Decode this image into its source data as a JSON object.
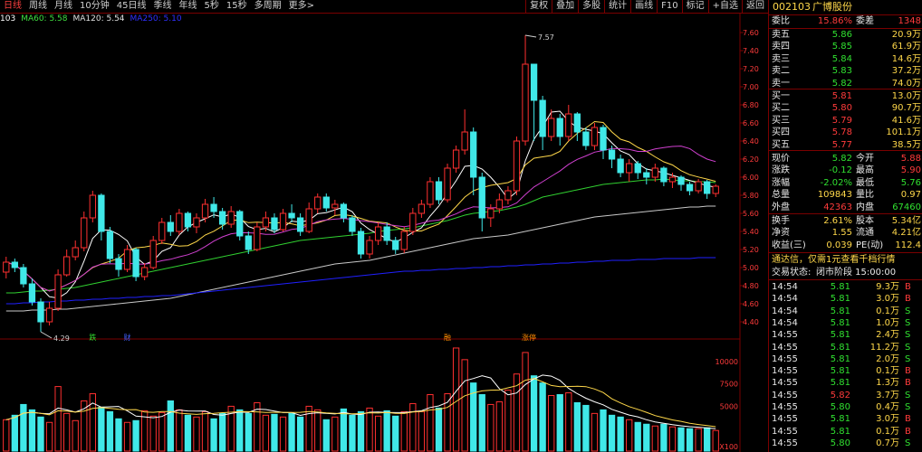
{
  "toolbar": {
    "tabs": [
      "日线",
      "周线",
      "月线",
      "10分钟",
      "45日线",
      "季线",
      "年线",
      "5秒",
      "15秒",
      "多周期",
      "更多>"
    ],
    "active_tab": 0,
    "tools": [
      "复权",
      "叠加",
      "多股",
      "统计",
      "画线",
      "F10",
      "标记",
      "+自选",
      "返回"
    ]
  },
  "ma_legend": [
    {
      "text": "103",
      "color": "#ffffff"
    },
    {
      "text": "MA60: 5.58",
      "color": "#40e040"
    },
    {
      "text": "MA120: 5.54",
      "color": "#e0e0e0"
    },
    {
      "text": "MA250: 5.10",
      "color": "#3030ff"
    }
  ],
  "chart_data": {
    "type": "candlestick",
    "y_ticks": [
      4.4,
      4.6,
      4.8,
      5.0,
      5.2,
      5.4,
      5.6,
      5.8,
      6.0,
      6.2,
      6.4,
      6.6,
      6.8,
      7.0,
      7.2,
      7.4,
      7.6
    ],
    "y_tick_labels": [
      "4.40",
      "4.60",
      "4.80",
      "5.00",
      "5.20",
      "5.40",
      "5.60",
      "5.80",
      "6.00",
      "6.20",
      "6.40",
      "6.60",
      "6.80",
      "7.00",
      "7.20",
      "7.40",
      "7.60"
    ],
    "ylim": [
      4.28,
      7.74
    ],
    "annotations": [
      {
        "text": "7.57",
        "index": 60,
        "value": 7.57
      },
      {
        "text": "4.29",
        "index": 4,
        "value": 4.29
      }
    ],
    "markers": [
      {
        "text": "跌",
        "index": 10,
        "color": "#30e030"
      },
      {
        "text": "财",
        "index": 14,
        "color": "#4060ff"
      },
      {
        "text": "融",
        "index": 51,
        "color": "#ff8c00"
      },
      {
        "text": "涨停",
        "index": 60,
        "color": "#ff8c00"
      }
    ],
    "candles": [
      [
        4.95,
        5.06,
        5.12,
        4.88
      ],
      [
        5.06,
        5.0,
        5.1,
        4.95
      ],
      [
        5.0,
        4.82,
        5.04,
        4.78
      ],
      [
        4.82,
        4.62,
        4.88,
        4.58
      ],
      [
        4.62,
        4.4,
        4.66,
        4.29
      ],
      [
        4.4,
        4.55,
        4.62,
        4.36
      ],
      [
        4.55,
        4.92,
        4.98,
        4.52
      ],
      [
        4.92,
        5.12,
        5.2,
        4.9
      ],
      [
        5.12,
        5.22,
        5.3,
        5.08
      ],
      [
        5.22,
        5.55,
        5.62,
        5.18
      ],
      [
        5.55,
        5.8,
        5.85,
        5.5
      ],
      [
        5.8,
        5.4,
        5.82,
        5.3
      ],
      [
        5.4,
        5.1,
        5.45,
        5.05
      ],
      [
        5.1,
        4.98,
        5.15,
        4.9
      ],
      [
        4.98,
        5.2,
        5.25,
        4.95
      ],
      [
        5.2,
        4.9,
        5.22,
        4.85
      ],
      [
        4.9,
        5.0,
        5.05,
        4.86
      ],
      [
        5.0,
        5.3,
        5.35,
        4.98
      ],
      [
        5.3,
        5.5,
        5.55,
        5.26
      ],
      [
        5.5,
        5.4,
        5.58,
        5.35
      ],
      [
        5.4,
        5.6,
        5.65,
        5.36
      ],
      [
        5.6,
        5.45,
        5.62,
        5.4
      ],
      [
        5.45,
        5.55,
        5.6,
        5.38
      ],
      [
        5.55,
        5.7,
        5.76,
        5.5
      ],
      [
        5.7,
        5.62,
        5.78,
        5.55
      ],
      [
        5.62,
        5.48,
        5.66,
        5.42
      ],
      [
        5.48,
        5.62,
        5.68,
        5.44
      ],
      [
        5.62,
        5.35,
        5.64,
        5.3
      ],
      [
        5.35,
        5.2,
        5.4,
        5.15
      ],
      [
        5.2,
        5.45,
        5.5,
        5.18
      ],
      [
        5.45,
        5.55,
        5.62,
        5.4
      ],
      [
        5.55,
        5.42,
        5.6,
        5.38
      ],
      [
        5.42,
        5.6,
        5.65,
        5.4
      ],
      [
        5.6,
        5.55,
        5.7,
        5.5
      ],
      [
        5.55,
        5.4,
        5.6,
        5.35
      ],
      [
        5.4,
        5.65,
        5.72,
        5.38
      ],
      [
        5.65,
        5.78,
        5.82,
        5.6
      ],
      [
        5.78,
        5.66,
        5.82,
        5.62
      ],
      [
        5.66,
        5.7,
        5.75,
        5.58
      ],
      [
        5.7,
        5.55,
        5.72,
        5.5
      ],
      [
        5.55,
        5.4,
        5.58,
        5.35
      ],
      [
        5.4,
        5.15,
        5.44,
        5.1
      ],
      [
        5.15,
        5.3,
        5.35,
        5.1
      ],
      [
        5.3,
        5.45,
        5.5,
        5.25
      ],
      [
        5.45,
        5.3,
        5.5,
        5.25
      ],
      [
        5.3,
        5.2,
        5.34,
        5.15
      ],
      [
        5.2,
        5.4,
        5.45,
        5.16
      ],
      [
        5.4,
        5.6,
        5.66,
        5.36
      ],
      [
        5.6,
        5.7,
        5.75,
        5.55
      ],
      [
        5.7,
        5.95,
        6.0,
        5.66
      ],
      [
        5.95,
        5.75,
        6.0,
        5.7
      ],
      [
        5.75,
        6.1,
        6.15,
        5.72
      ],
      [
        6.1,
        6.3,
        6.35,
        6.05
      ],
      [
        6.3,
        6.5,
        6.75,
        6.25
      ],
      [
        6.5,
        6.0,
        6.55,
        5.8
      ],
      [
        6.0,
        5.55,
        6.05,
        5.4
      ],
      [
        5.55,
        5.65,
        5.7,
        5.45
      ],
      [
        5.65,
        5.75,
        5.82,
        5.6
      ],
      [
        5.75,
        5.85,
        5.9,
        5.7
      ],
      [
        5.85,
        6.4,
        6.45,
        5.8
      ],
      [
        6.4,
        7.25,
        7.57,
        6.35
      ],
      [
        7.25,
        6.85,
        7.1,
        6.4
      ],
      [
        6.85,
        6.45,
        6.9,
        6.3
      ],
      [
        6.45,
        6.65,
        6.75,
        6.4
      ],
      [
        6.65,
        6.45,
        6.7,
        6.35
      ],
      [
        6.45,
        6.7,
        6.8,
        6.4
      ],
      [
        6.7,
        6.5,
        6.72,
        6.4
      ],
      [
        6.5,
        6.35,
        6.55,
        6.3
      ],
      [
        6.35,
        6.55,
        6.6,
        6.3
      ],
      [
        6.55,
        6.3,
        6.58,
        6.2
      ],
      [
        6.3,
        6.2,
        6.35,
        6.1
      ],
      [
        6.2,
        6.05,
        6.25,
        6.0
      ],
      [
        6.05,
        6.15,
        6.2,
        5.95
      ],
      [
        6.15,
        6.05,
        6.18,
        5.98
      ],
      [
        6.05,
        6.0,
        6.1,
        5.92
      ],
      [
        6.0,
        6.1,
        6.15,
        5.95
      ],
      [
        6.1,
        5.95,
        6.12,
        5.9
      ],
      [
        5.95,
        6.0,
        6.05,
        5.88
      ],
      [
        6.0,
        5.92,
        6.02,
        5.85
      ],
      [
        5.92,
        5.85,
        5.95,
        5.8
      ],
      [
        5.85,
        5.95,
        5.98,
        5.82
      ],
      [
        5.95,
        5.82,
        5.97,
        5.76
      ],
      [
        5.82,
        5.9,
        5.92,
        5.78
      ]
    ],
    "volume": [
      3500,
      4000,
      5200,
      4600,
      3800,
      3200,
      7200,
      4200,
      3400,
      5600,
      6400,
      4900,
      4400,
      3600,
      3200,
      3400,
      4500,
      3900,
      4300,
      5600,
      4600,
      4000,
      3800,
      4400,
      3600,
      4200,
      5000,
      4600,
      4200,
      5400,
      4000,
      4100,
      3800,
      4200,
      3800,
      5000,
      4600,
      3500,
      3800,
      4700,
      4000,
      4400,
      4800,
      3900,
      4500,
      3900,
      4400,
      5300,
      4400,
      6300,
      4800,
      6400,
      11500,
      10200,
      7600,
      6300,
      5200,
      5500,
      6800,
      8600,
      11000,
      8400,
      7600,
      6200,
      6300,
      6500,
      5400,
      5100,
      4200,
      4600,
      4000,
      3800,
      3500,
      3200,
      3000,
      2800,
      3000,
      2700,
      2600,
      2500,
      2500,
      2600,
      2300
    ],
    "vol_ticks": [
      5000,
      7500,
      10000
    ],
    "vol_tick_labels": [
      "5000",
      "7500",
      "10000"
    ],
    "vol_unit_label": "X100",
    "vol_ylim": [
      0,
      12000
    ],
    "ma_lines": [
      {
        "name": "MA60",
        "color": "#30d030",
        "values": [
          4.72,
          4.72,
          4.73,
          4.74,
          4.74,
          4.75,
          4.76,
          4.77,
          4.78,
          4.8,
          4.82,
          4.84,
          4.86,
          4.88,
          4.9,
          4.92,
          4.94,
          4.96,
          4.98,
          5.0,
          5.02,
          5.04,
          5.06,
          5.08,
          5.1,
          5.12,
          5.14,
          5.16,
          5.18,
          5.2,
          5.22,
          5.24,
          5.26,
          5.28,
          5.3,
          5.31,
          5.32,
          5.33,
          5.34,
          5.35,
          5.36,
          5.37,
          5.38,
          5.4,
          5.41,
          5.42,
          5.43,
          5.44,
          5.46,
          5.48,
          5.5,
          5.52,
          5.55,
          5.58,
          5.6,
          5.61,
          5.62,
          5.63,
          5.65,
          5.67,
          5.7,
          5.74,
          5.78,
          5.8,
          5.82,
          5.84,
          5.86,
          5.88,
          5.9,
          5.92,
          5.93,
          5.94,
          5.95,
          5.96,
          5.97,
          5.97,
          5.98,
          5.97,
          5.96,
          5.96,
          5.95,
          5.95,
          5.94
        ]
      },
      {
        "name": "MA120",
        "color": "#c8c8c8",
        "values": [
          4.52,
          4.52,
          4.52,
          4.53,
          4.53,
          4.53,
          4.54,
          4.54,
          4.55,
          4.56,
          4.57,
          4.58,
          4.59,
          4.6,
          4.61,
          4.62,
          4.63,
          4.64,
          4.65,
          4.66,
          4.68,
          4.7,
          4.72,
          4.74,
          4.76,
          4.78,
          4.8,
          4.82,
          4.84,
          4.86,
          4.88,
          4.9,
          4.92,
          4.94,
          4.96,
          4.98,
          5.0,
          5.02,
          5.04,
          5.05,
          5.06,
          5.07,
          5.08,
          5.1,
          5.12,
          5.14,
          5.16,
          5.18,
          5.2,
          5.22,
          5.24,
          5.26,
          5.28,
          5.3,
          5.32,
          5.33,
          5.34,
          5.35,
          5.36,
          5.38,
          5.4,
          5.42,
          5.44,
          5.46,
          5.48,
          5.5,
          5.52,
          5.54,
          5.56,
          5.57,
          5.58,
          5.59,
          5.6,
          5.61,
          5.62,
          5.63,
          5.64,
          5.65,
          5.66,
          5.67,
          5.67,
          5.68,
          5.68
        ]
      },
      {
        "name": "MA250",
        "color": "#2020ff",
        "values": [
          4.6,
          4.6,
          4.61,
          4.61,
          4.62,
          4.62,
          4.63,
          4.63,
          4.64,
          4.64,
          4.65,
          4.65,
          4.66,
          4.66,
          4.67,
          4.67,
          4.68,
          4.68,
          4.69,
          4.69,
          4.7,
          4.71,
          4.72,
          4.73,
          4.74,
          4.75,
          4.76,
          4.77,
          4.78,
          4.79,
          4.8,
          4.81,
          4.82,
          4.83,
          4.84,
          4.85,
          4.86,
          4.87,
          4.88,
          4.89,
          4.9,
          4.91,
          4.92,
          4.93,
          4.94,
          4.95,
          4.96,
          4.96,
          4.97,
          4.97,
          4.98,
          4.98,
          4.99,
          4.99,
          5.0,
          5.0,
          5.01,
          5.01,
          5.02,
          5.02,
          5.03,
          5.03,
          5.04,
          5.04,
          5.05,
          5.05,
          5.06,
          5.06,
          5.07,
          5.07,
          5.08,
          5.08,
          5.08,
          5.09,
          5.09,
          5.09,
          5.1,
          5.1,
          5.1,
          5.1,
          5.11,
          5.11,
          5.11
        ]
      }
    ]
  },
  "side": {
    "code": "002103",
    "name": "广博股份",
    "weibi_label": "委比",
    "weibi_value": "15.86%",
    "weicha_label": "委差",
    "weicha_value": "1348",
    "asks": [
      {
        "label": "卖五",
        "price": "5.86",
        "vol": "20.9万"
      },
      {
        "label": "卖四",
        "price": "5.85",
        "vol": "61.9万"
      },
      {
        "label": "卖三",
        "price": "5.84",
        "vol": "14.6万"
      },
      {
        "label": "卖二",
        "price": "5.83",
        "vol": "37.2万"
      },
      {
        "label": "卖一",
        "price": "5.82",
        "vol": "74.0万"
      }
    ],
    "bids": [
      {
        "label": "买一",
        "price": "5.81",
        "vol": "13.0万"
      },
      {
        "label": "买二",
        "price": "5.80",
        "vol": "90.7万"
      },
      {
        "label": "买三",
        "price": "5.79",
        "vol": "41.6万"
      },
      {
        "label": "买四",
        "price": "5.78",
        "vol": "101.1万"
      },
      {
        "label": "买五",
        "price": "5.77",
        "vol": "38.5万"
      }
    ],
    "quote": [
      {
        "l1": "现价",
        "v1": "5.82",
        "c1": "grn",
        "l2": "今开",
        "v2": "5.88",
        "c2": "red"
      },
      {
        "l1": "涨跌",
        "v1": "-0.12",
        "c1": "grn",
        "l2": "最高",
        "v2": "5.90",
        "c2": "red"
      },
      {
        "l1": "涨幅",
        "v1": "-2.02%",
        "c1": "grn",
        "l2": "最低",
        "v2": "5.76",
        "c2": "grn"
      },
      {
        "l1": "总量",
        "v1": "109843",
        "c1": "y",
        "l2": "量比",
        "v2": "0.97",
        "c2": "y"
      },
      {
        "l1": "外盘",
        "v1": "42363",
        "c1": "red",
        "l2": "内盘",
        "v2": "67460",
        "c2": "grn"
      }
    ],
    "stats": [
      {
        "l1": "换手",
        "v1": "2.61%",
        "l2": "股本",
        "v2": "5.34亿"
      },
      {
        "l1": "净资",
        "v1": "1.55",
        "l2": "流通",
        "v2": "4.21亿"
      },
      {
        "l1": "收益(三)",
        "v1": "0.039",
        "l2": "PE(动)",
        "v2": "112.4"
      }
    ],
    "promo": "通达信，仅需1元查看千档行情",
    "status_label": "交易状态:",
    "status_value": "闭市阶段 15:00:00",
    "ticks": [
      {
        "t": "14:54",
        "p": "5.81",
        "v": "9.3万",
        "s": "B"
      },
      {
        "t": "14:54",
        "p": "5.81",
        "v": "3.0万",
        "s": "B"
      },
      {
        "t": "14:54",
        "p": "5.81",
        "v": "0.1万",
        "s": "S"
      },
      {
        "t": "14:54",
        "p": "5.81",
        "v": "1.0万",
        "s": "S"
      },
      {
        "t": "14:55",
        "p": "5.81",
        "v": "2.4万",
        "s": "S"
      },
      {
        "t": "14:55",
        "p": "5.81",
        "v": "11.2万",
        "s": "S"
      },
      {
        "t": "14:55",
        "p": "5.81",
        "v": "2.0万",
        "s": "S"
      },
      {
        "t": "14:55",
        "p": "5.81",
        "v": "0.1万",
        "s": "B"
      },
      {
        "t": "14:55",
        "p": "5.81",
        "v": "1.3万",
        "s": "B"
      },
      {
        "t": "14:55",
        "p": "5.82",
        "v": "3.7万",
        "s": "S"
      },
      {
        "t": "14:55",
        "p": "5.80",
        "v": "0.4万",
        "s": "S"
      },
      {
        "t": "14:55",
        "p": "5.81",
        "v": "3.0万",
        "s": "B"
      },
      {
        "t": "14:55",
        "p": "5.81",
        "v": "0.1万",
        "s": "B"
      },
      {
        "t": "14:55",
        "p": "5.80",
        "v": "0.7万",
        "s": "S"
      }
    ]
  }
}
